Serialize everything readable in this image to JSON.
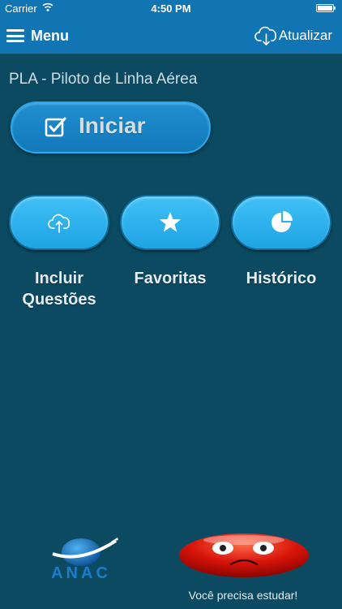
{
  "status_bar": {
    "carrier": "Carrier",
    "time": "4:50 PM"
  },
  "nav": {
    "menu_label": "Menu",
    "update_label": "Atualizar"
  },
  "course": {
    "title": "PLA - Piloto de Linha Aérea"
  },
  "start": {
    "label": "Iniciar"
  },
  "actions": [
    {
      "line1": "Incluir",
      "line2": "Questões",
      "icon": "cloud-upload-icon"
    },
    {
      "line1": "Favoritas",
      "line2": "",
      "icon": "star-icon"
    },
    {
      "line1": "Histórico",
      "line2": "",
      "icon": "pie-chart-icon"
    }
  ],
  "footer": {
    "logo_text": "ANAC",
    "message": "Você precisa estudar!"
  },
  "colors": {
    "nav": "#1275b3",
    "background": "#0b4a60",
    "pill": "#2fb3ee",
    "smiley": "#d8140a"
  }
}
